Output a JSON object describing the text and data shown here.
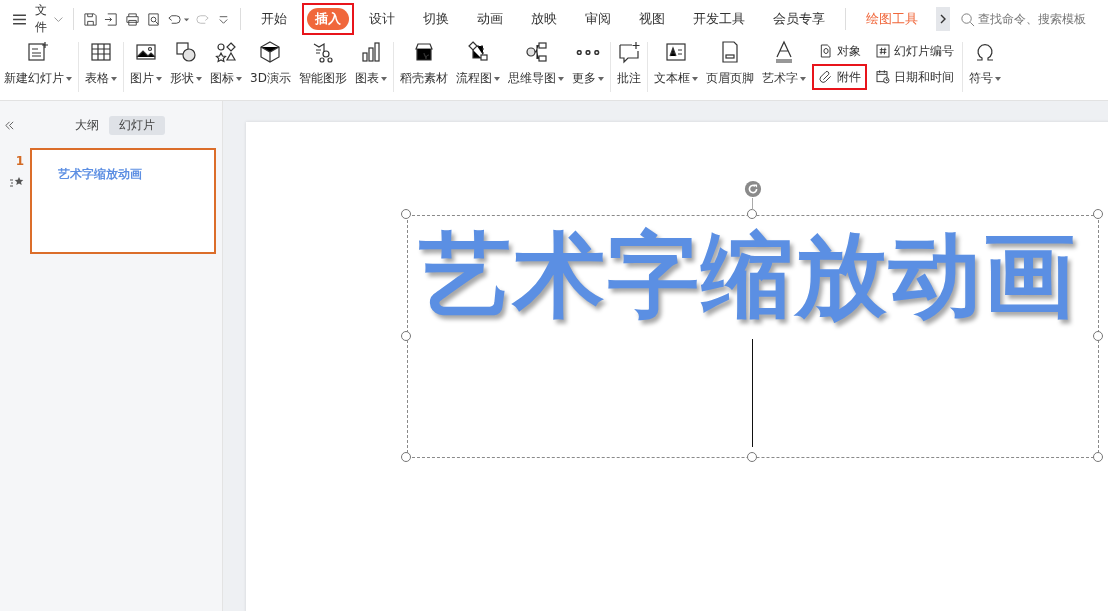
{
  "menu": {
    "file_label": "文件"
  },
  "tabs": [
    {
      "label": "开始",
      "selected": false,
      "highlighted": false,
      "kind": "normal"
    },
    {
      "label": "插入",
      "selected": true,
      "highlighted": true,
      "kind": "normal"
    },
    {
      "label": "设计",
      "selected": false,
      "highlighted": false,
      "kind": "normal"
    },
    {
      "label": "切换",
      "selected": false,
      "highlighted": false,
      "kind": "normal"
    },
    {
      "label": "动画",
      "selected": false,
      "highlighted": false,
      "kind": "normal"
    },
    {
      "label": "放映",
      "selected": false,
      "highlighted": false,
      "kind": "normal"
    },
    {
      "label": "审阅",
      "selected": false,
      "highlighted": false,
      "kind": "normal"
    },
    {
      "label": "视图",
      "selected": false,
      "highlighted": false,
      "kind": "normal"
    },
    {
      "label": "开发工具",
      "selected": false,
      "highlighted": false,
      "kind": "normal"
    },
    {
      "label": "会员专享",
      "selected": false,
      "highlighted": false,
      "kind": "normal"
    },
    {
      "label": "绘图工具",
      "selected": false,
      "highlighted": false,
      "kind": "contextual"
    }
  ],
  "search": {
    "placeholder": "查找命令、搜索模板"
  },
  "ribbon_groups": [
    [
      {
        "kind": "large",
        "label": "新建幻灯片",
        "dropdown": true
      }
    ],
    [
      {
        "kind": "large",
        "label": "表格",
        "dropdown": true
      }
    ],
    [
      {
        "kind": "large",
        "label": "图片",
        "dropdown": true
      },
      {
        "kind": "large",
        "label": "形状",
        "dropdown": true
      },
      {
        "kind": "large",
        "label": "图标",
        "dropdown": true
      },
      {
        "kind": "large",
        "label": "3D演示",
        "dropdown": false
      },
      {
        "kind": "large",
        "label": "智能图形",
        "dropdown": false
      },
      {
        "kind": "large",
        "label": "图表",
        "dropdown": true
      }
    ],
    [
      {
        "kind": "large",
        "label": "稻壳素材",
        "dropdown": false
      },
      {
        "kind": "large",
        "label": "流程图",
        "dropdown": true
      },
      {
        "kind": "large",
        "label": "思维导图",
        "dropdown": true
      },
      {
        "kind": "large",
        "label": "更多",
        "dropdown": true
      }
    ],
    [
      {
        "kind": "large",
        "label": "批注",
        "dropdown": false
      }
    ],
    [
      {
        "kind": "large",
        "label": "文本框",
        "dropdown": true
      },
      {
        "kind": "large",
        "label": "页眉页脚",
        "dropdown": false
      },
      {
        "kind": "large",
        "label": "艺术字",
        "dropdown": true
      },
      {
        "kind": "stack",
        "items": [
          {
            "label": "对象",
            "highlighted": false
          },
          {
            "label": "附件",
            "highlighted": true
          }
        ]
      },
      {
        "kind": "stack",
        "items": [
          {
            "label": "幻灯片编号",
            "highlighted": false
          },
          {
            "label": "日期和时间",
            "highlighted": false
          }
        ]
      }
    ],
    [
      {
        "kind": "large",
        "label": "符号",
        "dropdown": true
      }
    ]
  ],
  "panel_tabs": [
    {
      "label": "大纲",
      "selected": false
    },
    {
      "label": "幻灯片",
      "selected": true
    }
  ],
  "slides": [
    {
      "number": "1",
      "title": "艺术字缩放动画",
      "selected": true,
      "animated": true
    }
  ],
  "slide": {
    "title": "艺术字缩放动画"
  }
}
